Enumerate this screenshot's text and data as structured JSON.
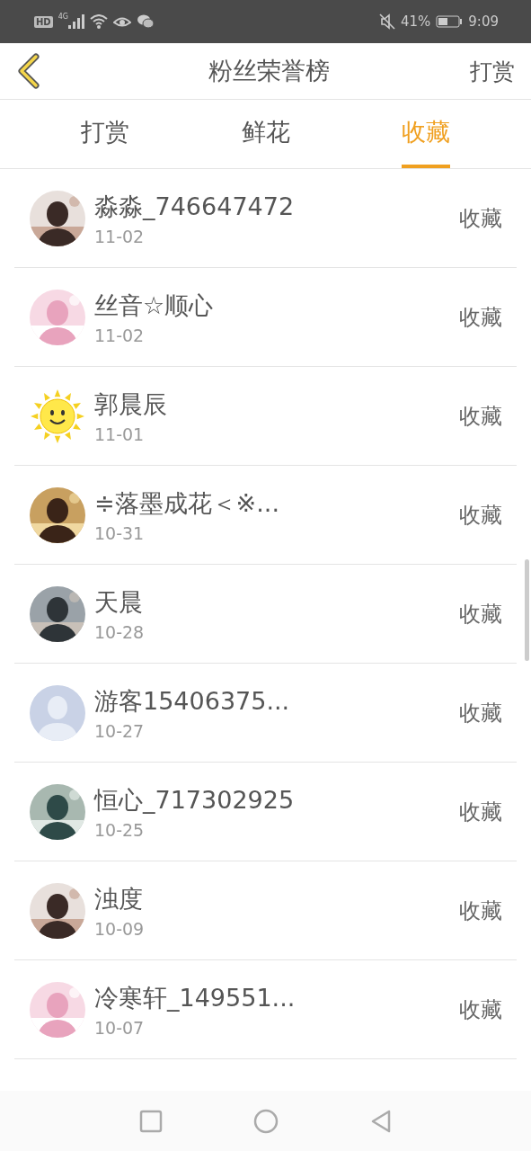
{
  "status_bar": {
    "hd": "HD",
    "network": "4G",
    "battery_percent": "41%",
    "time": "9:09"
  },
  "header": {
    "title": "粉丝荣誉榜",
    "action": "打赏"
  },
  "tabs": [
    {
      "label": "打赏",
      "selected": false
    },
    {
      "label": "鲜花",
      "selected": false
    },
    {
      "label": "收藏",
      "selected": true
    }
  ],
  "rows": [
    {
      "name": "淼淼_746647472",
      "date": "11-02",
      "action": "收藏"
    },
    {
      "name": "丝音☆顺心",
      "date": "11-02",
      "action": "收藏"
    },
    {
      "name": "郭晨辰",
      "date": "11-01",
      "action": "收藏",
      "avatar": {
        "kind": "sun"
      }
    },
    {
      "name": "≑落墨成花＜※...",
      "date": "10-31",
      "action": "收藏"
    },
    {
      "name": "天晨",
      "date": "10-28",
      "action": "收藏"
    },
    {
      "name": "游客15406375...",
      "date": "10-27",
      "action": "收藏",
      "avatar": {
        "kind": "default"
      }
    },
    {
      "name": "恒心_717302925",
      "date": "10-25",
      "action": "收藏"
    },
    {
      "name": "浊度",
      "date": "10-09",
      "action": "收藏"
    },
    {
      "name": "冷寒轩_149551...",
      "date": "10-07",
      "action": "收藏"
    }
  ]
}
